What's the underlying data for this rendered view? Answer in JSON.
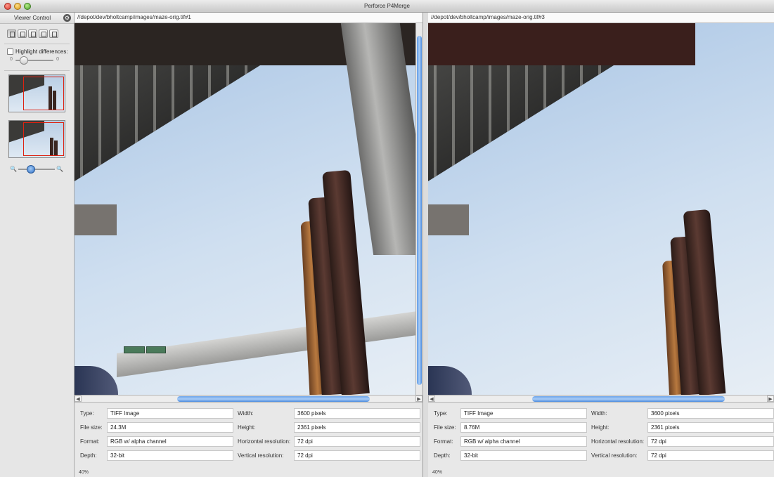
{
  "window": {
    "title": "Perforce P4Merge"
  },
  "sidebar": {
    "title": "Viewer Control",
    "highlight_label": "Highlight differences:",
    "slider_min": "0",
    "slider_max": "0",
    "highlight_level": 0.25,
    "zoom_level": 0.3
  },
  "left": {
    "path": "//depot/dev/bholtcamp/images/maze-orig.tif#1",
    "labels": {
      "type": "Type:",
      "file_size": "File size:",
      "format": "Format:",
      "depth": "Depth:",
      "width": "Width:",
      "height": "Height:",
      "hres": "Horizontal resolution:",
      "vres": "Vertical resolution:"
    },
    "type": "TIFF Image",
    "file_size": "24.3M",
    "format": "RGB w/ alpha channel",
    "depth": "32-bit",
    "width": "3600 pixels",
    "height": "2361 pixels",
    "hres": "72 dpi",
    "vres": "72 dpi",
    "zoom": "40%"
  },
  "right": {
    "path": "//depot/dev/bholtcamp/images/maze-orig.tif#3",
    "labels": {
      "type": "Type:",
      "file_size": "File size:",
      "format": "Format:",
      "depth": "Depth:",
      "width": "Width:",
      "height": "Height:",
      "hres": "Horizontal resolution:",
      "vres": "Vertical resolution:"
    },
    "type": "TIFF Image",
    "file_size": "8.76M",
    "format": "RGB w/ alpha channel",
    "depth": "32-bit",
    "width": "3600 pixels",
    "height": "2361 pixels",
    "hres": "72 dpi",
    "vres": "72 dpi",
    "zoom": "40%"
  },
  "colors": {
    "scroll_accent": "#5d9ae6",
    "thumb_frame": "#d21111"
  }
}
